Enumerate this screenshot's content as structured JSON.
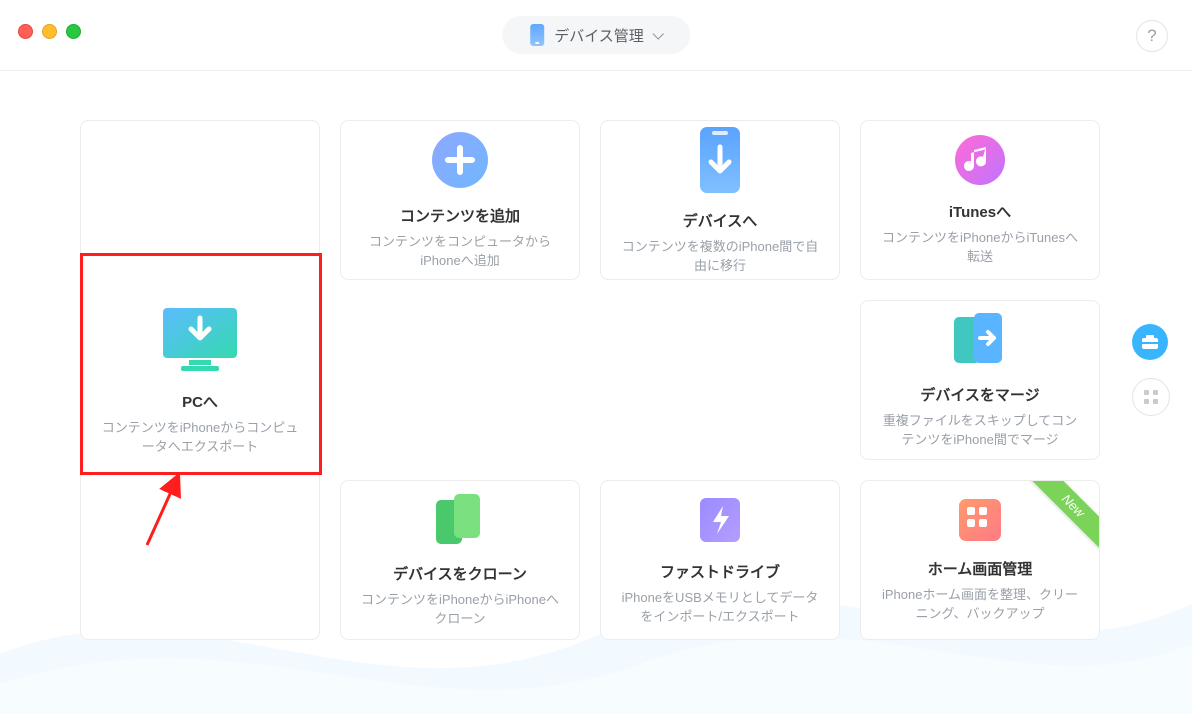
{
  "header": {
    "title": "デバイス管理"
  },
  "cards": {
    "pc": {
      "title": "PCへ",
      "desc": "コンテンツをiPhoneからコンピュータへエクスポート"
    },
    "add": {
      "title": "コンテンツを追加",
      "desc": "コンテンツをコンピュータからiPhoneへ追加"
    },
    "device": {
      "title": "デバイスへ",
      "desc": "コンテンツを複数のiPhone間で自由に移行"
    },
    "itunes": {
      "title": "iTunesへ",
      "desc": "コンテンツをiPhoneからiTunesへ転送"
    },
    "merge": {
      "title": "デバイスをマージ",
      "desc": "重複ファイルをスキップしてコンテンツをiPhone間でマージ"
    },
    "clone": {
      "title": "デバイスをクローン",
      "desc": "コンテンツをiPhoneからiPhoneへクローン"
    },
    "fast": {
      "title": "ファストドライブ",
      "desc": "iPhoneをUSBメモリとしてデータをインポート/エクスポート"
    },
    "home": {
      "title": "ホーム画面管理",
      "desc": "iPhoneホーム画面を整理、クリーニング、バックアップ"
    }
  },
  "badges": {
    "new": "New"
  }
}
